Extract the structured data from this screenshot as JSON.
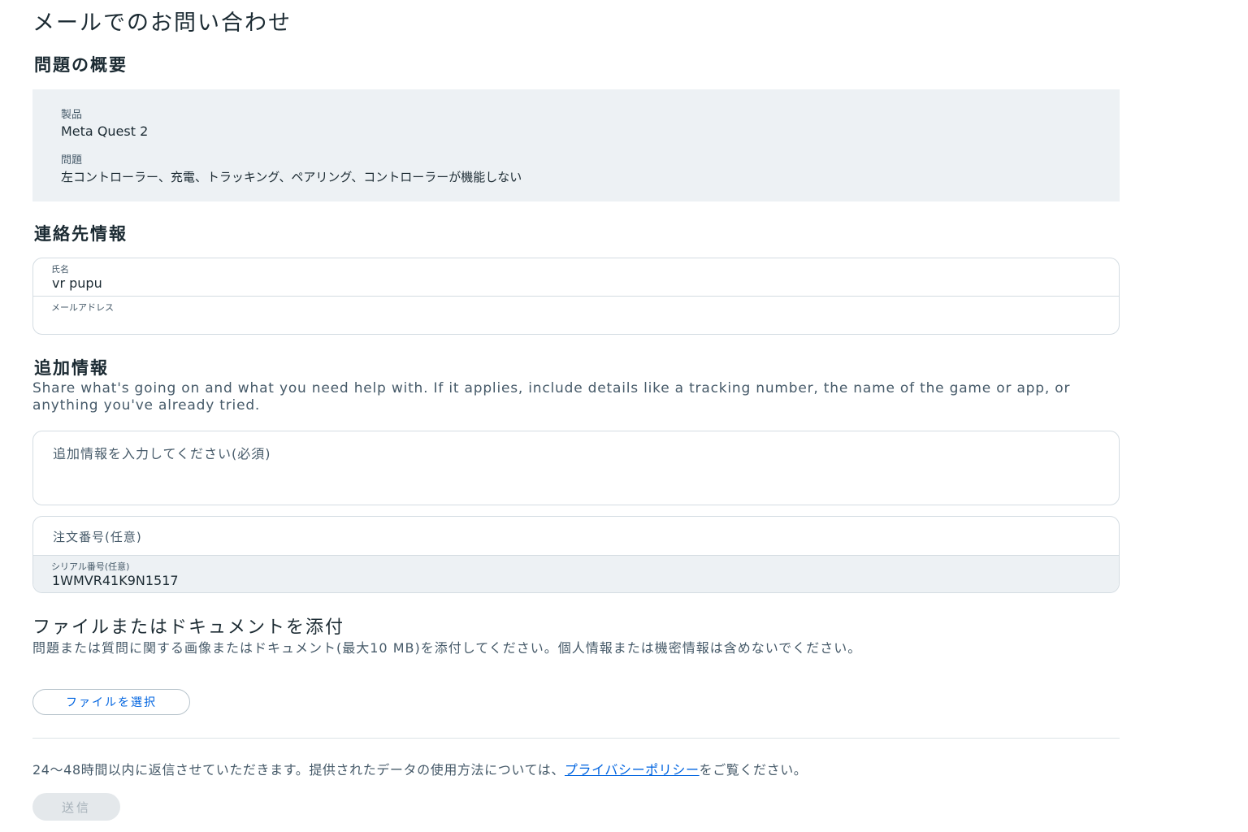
{
  "page_title": "メールでのお問い合わせ",
  "summary": {
    "heading": "問題の概要",
    "product_label": "製品",
    "product_value": "Meta Quest 2",
    "issue_label": "問題",
    "issue_value": "左コントローラー、充電、トラッキング、ペアリング、コントローラーが機能しない"
  },
  "contact": {
    "heading": "連絡先情報",
    "name_label": "氏名",
    "name_value": "vr pupu",
    "email_label": "メールアドレス",
    "email_value": ""
  },
  "additional": {
    "heading": "追加情報",
    "description": "Share what's going on and what you need help with. If it applies, include details like a tracking number, the name of the game or app, or anything you've already tried.",
    "details_placeholder": "追加情報を入力してください(必須)",
    "order_placeholder": "注文番号(任意)",
    "serial_label": "シリアル番号(任意)",
    "serial_value": "1WMVR41K9N1517"
  },
  "attachment": {
    "heading": "ファイルまたはドキュメントを添付",
    "description": "問題または質問に関する画像またはドキュメント(最大10 MB)を添付してください。個人情報または機密情報は含めないでください。",
    "button_label": "ファイルを選択"
  },
  "footer": {
    "text_before": "24～48時間以内に返信させていただきます。提供されたデータの使用方法については、",
    "link_text": "プライバシーポリシー",
    "text_after": "をご覧ください。",
    "submit_label": "送信"
  },
  "colors": {
    "link": "#0064e0",
    "summary_bg": "#edf1f4",
    "disabled_button_bg": "#e4e8eb"
  }
}
